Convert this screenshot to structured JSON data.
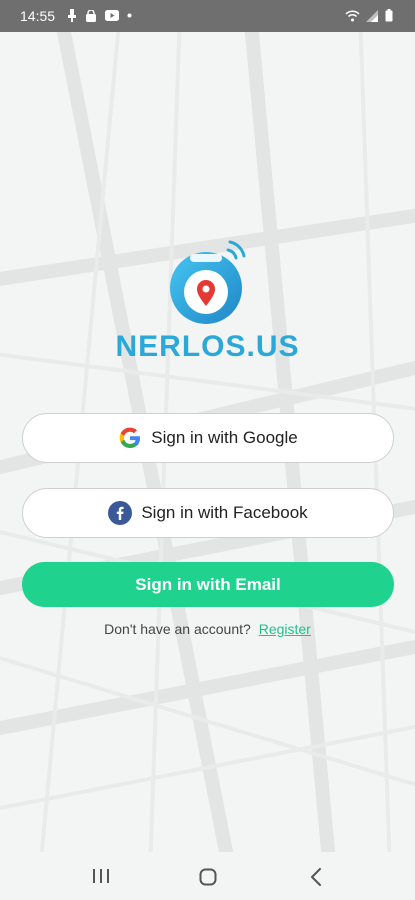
{
  "status_bar": {
    "time": "14:55",
    "left_icons": [
      "usb-icon",
      "bag-icon",
      "youtube-icon",
      "dot-icon"
    ],
    "right_icons": [
      "wifi-icon",
      "signal-icon",
      "battery-icon"
    ]
  },
  "brand": {
    "name": "NERLOS.US",
    "color": "#2aa9d8"
  },
  "buttons": {
    "google_label": "Sign in with Google",
    "facebook_label": "Sign in with Facebook",
    "email_label": "Sign in with Email",
    "email_color": "#1fd38e"
  },
  "register": {
    "prompt": "Don't have an account?",
    "link": "Register"
  },
  "nav_bar": {
    "items": [
      "recents-icon",
      "home-icon",
      "back-icon"
    ]
  }
}
